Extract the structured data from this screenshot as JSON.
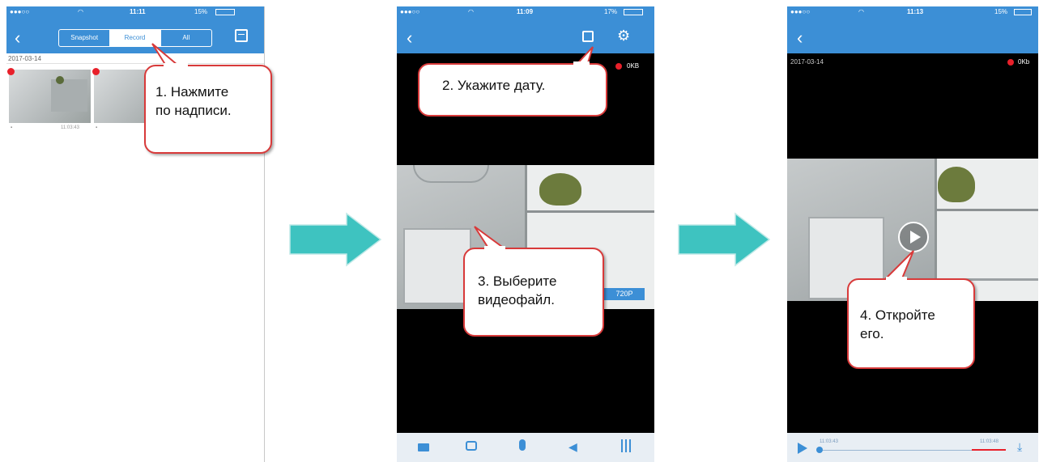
{
  "phone1": {
    "status": {
      "time": "11:11",
      "battery": "15%"
    },
    "tabs": [
      "Snapshot",
      "Record",
      "All"
    ],
    "date": "2017-03-14",
    "thumbs": [
      {
        "time": "11:03:43"
      },
      {
        "time": ""
      }
    ]
  },
  "phone2": {
    "status": {
      "time": "11:09",
      "battery": "17%"
    },
    "rec_size": "0KB",
    "quality": "720P",
    "toolbar_icons": [
      "video-icon",
      "camera-icon",
      "mic-icon",
      "speaker-mute-icon",
      "equalizer-icon"
    ]
  },
  "phone3": {
    "status": {
      "time": "11:13",
      "battery": "15%"
    },
    "date": "2017-03-14",
    "rec_size": "0Kb",
    "player": {
      "start_time": "11:03:43",
      "end_time": "11:03:48"
    }
  },
  "callouts": {
    "c1": "1. Нажмите\nпо надписи.",
    "c2": "2. Укажите дату.",
    "c3": "3. Выберите\nвидеофайл.",
    "c4": "4. Откройте\nего."
  },
  "colors": {
    "nav_blue": "#3c8fd6",
    "callout_border": "#d83a3a",
    "arrow_teal": "#3ec3c0",
    "rec_red": "#e8202a"
  }
}
